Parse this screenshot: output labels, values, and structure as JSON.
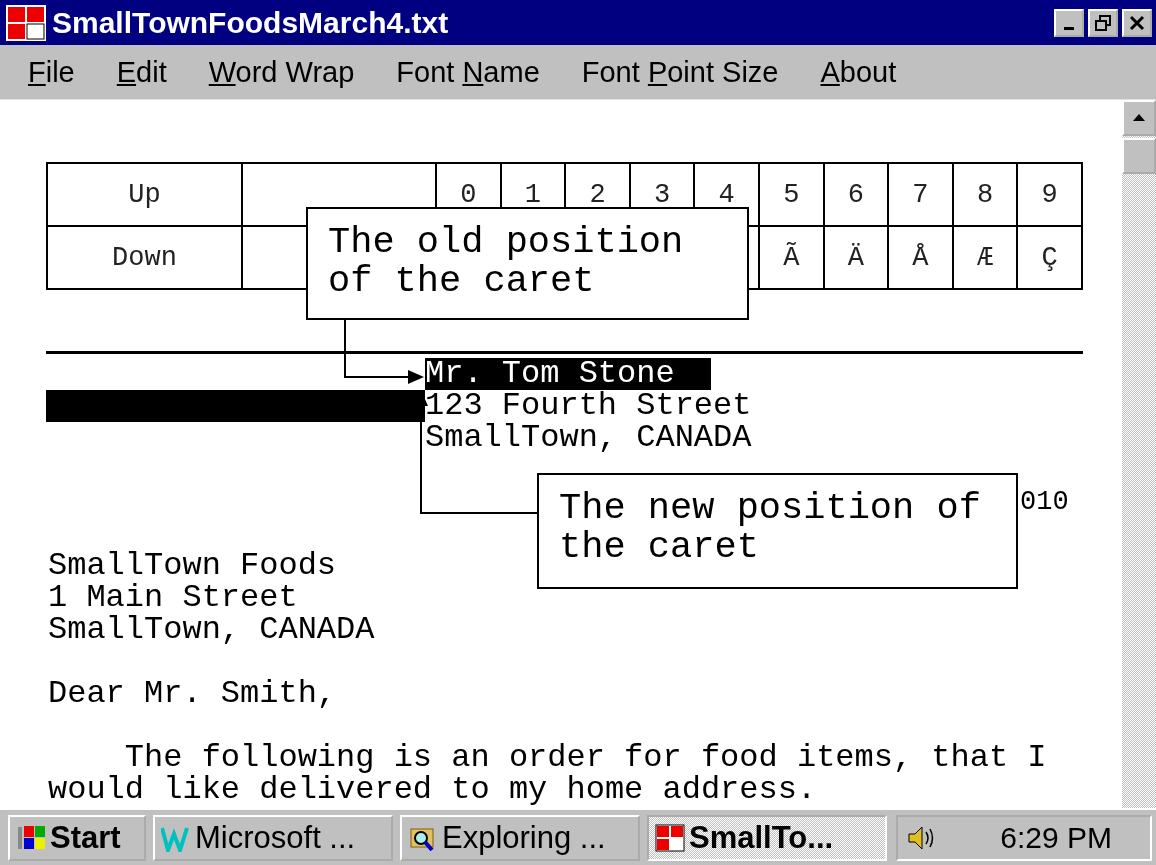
{
  "window": {
    "title": "SmallTownFoodsMarch4.txt"
  },
  "menu": [
    {
      "key": "F",
      "after": "ile"
    },
    {
      "key": "E",
      "after": "dit"
    },
    {
      "key": "W",
      "after": "ord Wrap"
    },
    {
      "before": "Font ",
      "key": "N",
      "after": "ame"
    },
    {
      "before": "Font ",
      "key": "P",
      "after": "oint Size"
    },
    {
      "key": "A",
      "after": "bout"
    }
  ],
  "table": {
    "rows": [
      {
        "label": "Up",
        "values": [
          "0",
          "1",
          "2",
          "3",
          "4",
          "5",
          "6",
          "7",
          "8",
          "9"
        ]
      },
      {
        "label": "Down",
        "values": [
          "Ã",
          "Ä",
          "Å",
          "Æ",
          "Ç"
        ]
      }
    ]
  },
  "recipient": [
    {
      "text": "Mr. Tom Stone",
      "selected": true,
      "leading_bar": false
    },
    {
      "text": "123 Fourth Street",
      "selected": false,
      "leading_bar": true
    },
    {
      "text": "SmallTown, CANADA",
      "selected": false,
      "leading_bar": false
    }
  ],
  "date_fragment": "010",
  "sender": [
    "SmallTown Foods",
    "1 Main Street",
    "SmallTown, CANADA"
  ],
  "salutation": "Dear Mr. Smith,",
  "body": [
    "    The following is an order for food items, that I",
    "would like delivered to my home address."
  ],
  "callouts": [
    {
      "kind": "old",
      "text": "The old position\nof the caret"
    },
    {
      "kind": "new",
      "text": "The new position of\nthe caret"
    }
  ],
  "taskbar": {
    "start": "Start",
    "tasks": [
      {
        "kind": "word",
        "label": "Microsoft ...",
        "selected": false
      },
      {
        "kind": "explorer",
        "label": "Exploring ...",
        "selected": false
      },
      {
        "kind": "app",
        "label": "SmallTo...",
        "selected": true
      }
    ],
    "clock": "6:29 PM"
  }
}
